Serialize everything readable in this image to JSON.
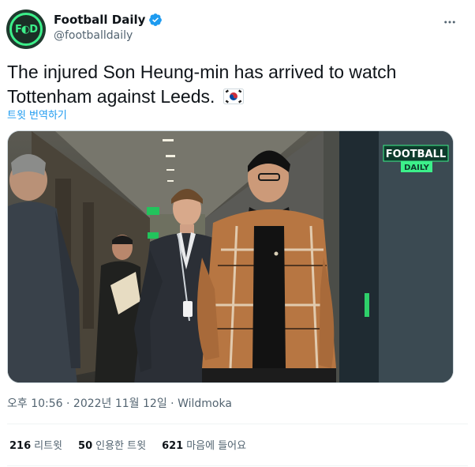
{
  "author": {
    "display_name": "Football Daily",
    "handle": "@footballdaily",
    "avatar_text": "F◐D",
    "verified": true
  },
  "tweet": {
    "text": "The injured Son Heung-min has arrived to watch Tottenham against Leeds.",
    "flag": "kr-flag",
    "translate_label": "트윗 번역하기"
  },
  "media": {
    "badge_top": "FOOTBALL",
    "badge_bottom": "DAILY"
  },
  "meta": {
    "timestamp": "오후 10:56 · 2022년 11월 12일",
    "separator": "·",
    "source": "Wildmoka"
  },
  "stats": {
    "retweets_count": "216",
    "retweets_label": "리트윗",
    "quotes_count": "50",
    "quotes_label": "인용한 트윗",
    "likes_count": "621",
    "likes_label": "마음에 들어요"
  },
  "colors": {
    "accent": "#1d9bf0",
    "brand_green": "#3cf08a",
    "text_primary": "#0f1419",
    "text_secondary": "#536471"
  }
}
